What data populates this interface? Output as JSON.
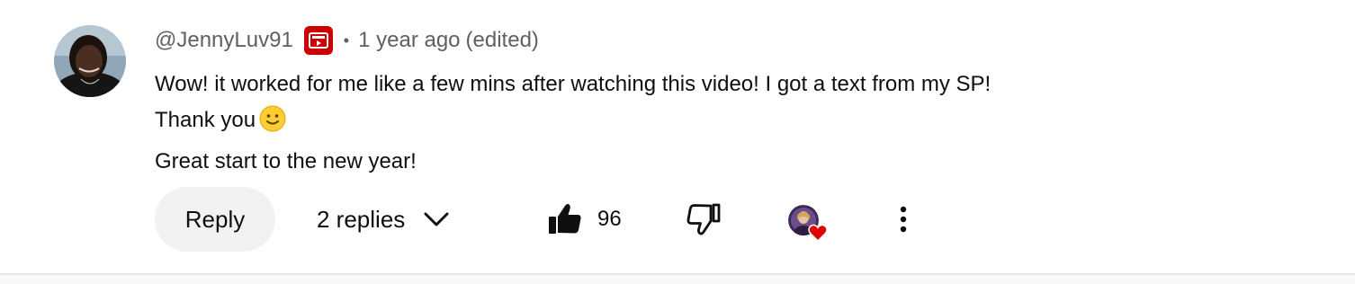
{
  "comment": {
    "author_handle": "@JennyLuv91",
    "member_badge_icon": "membership-play-icon",
    "separator": "•",
    "timestamp": "1 year ago",
    "edited": "(edited)",
    "lines": [
      "Wow! it worked for me like a few mins after watching this video! I got a text from my SP!",
      "Thank you",
      "Great start to the new year!"
    ],
    "emoji": "slightly-smiling-face-emoji",
    "actions": {
      "reply_label": "Reply",
      "replies_label": "2 replies",
      "replies_icon": "chevron-down-icon",
      "like_icon": "thumbs-up-icon",
      "like_count": "96",
      "dislike_icon": "thumbs-down-icon",
      "creator_heart_icon": "heart-icon",
      "more_icon": "more-vertical-icon"
    },
    "colors": {
      "badge": "#cc0000",
      "heart": "#e00000",
      "meta_text": "#606060",
      "reply_bg": "#f2f2f2"
    }
  }
}
